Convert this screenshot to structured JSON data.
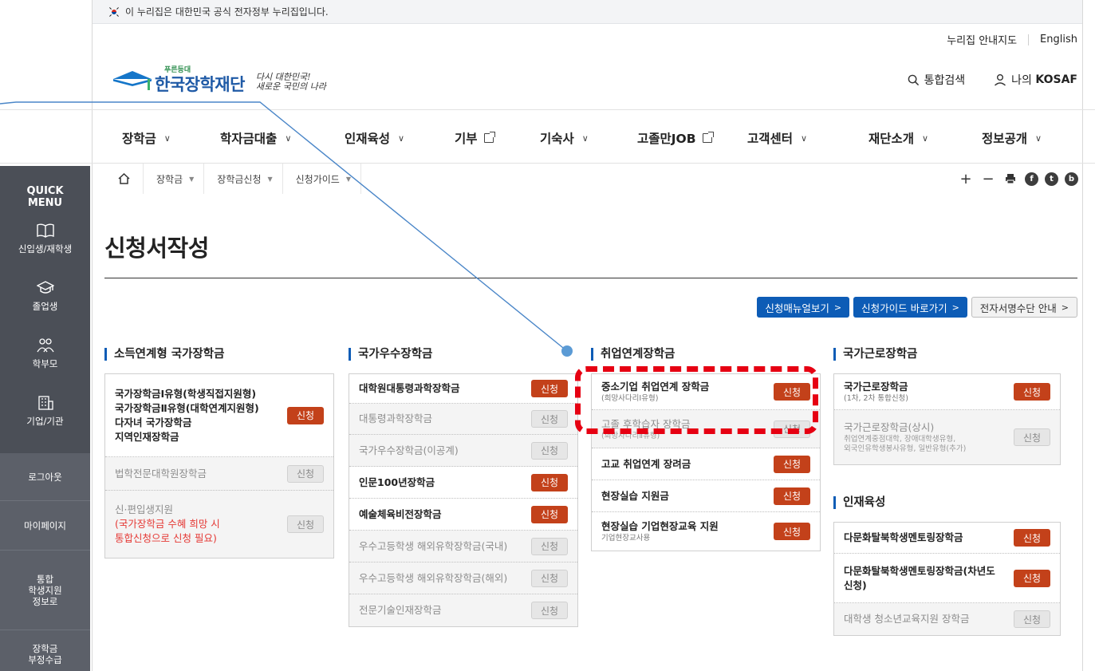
{
  "gov_banner": "이 누리집은 대한민국 공식 전자정부 누리집입니다.",
  "util_links": {
    "sitemap": "누리집 안내지도",
    "english": "English"
  },
  "logo": {
    "sub": "푸른등대",
    "name": "한국장학재단",
    "slogan_line1": "다시 대한민국!",
    "slogan_line2": "새로운 국민의 나라"
  },
  "header": {
    "search": "통합검색",
    "my_prefix": "나의",
    "my_brand": "KOSAF"
  },
  "gnb": [
    {
      "label": "장학금",
      "chev": "∨"
    },
    {
      "label": "학자금대출",
      "chev": "∨"
    },
    {
      "label": "인재육성",
      "chev": "∨"
    },
    {
      "label": "기부",
      "ext": true
    },
    {
      "label": "기숙사",
      "chev": "∨"
    },
    {
      "label": "고졸만JOB",
      "ext": true
    },
    {
      "label": "고객센터",
      "chev": "∨"
    },
    {
      "label": "재단소개",
      "chev": "∨"
    },
    {
      "label": "정보공개",
      "chev": "∨"
    }
  ],
  "quick_menu": {
    "title_line1": "QUICK",
    "title_line2": "MENU",
    "items": [
      "신입생/재학생",
      "졸업생",
      "학부모",
      "기업/기관"
    ],
    "links": [
      "로그아웃",
      "마이페이지",
      "통합\n학생지원\n정보로",
      "장학금\n부정수급"
    ]
  },
  "breadcrumb": [
    "장학금",
    "장학금신청",
    "신청가이드"
  ],
  "page_title": "신청서작성",
  "top_buttons": {
    "manual": "신청매뉴얼보기",
    "guide": "신청가이드 바로가기",
    "esign": "전자서명수단 안내"
  },
  "apply_label": "신청",
  "columns": {
    "income": {
      "title": "소득연계형 국가장학금",
      "rows": [
        {
          "lines": [
            "국가장학금Ⅰ유형(학생직접지원형)",
            "국가장학금Ⅱ유형(대학연계지원형)",
            "다자녀 국가장학금",
            "지역인재장학금"
          ],
          "active": true
        },
        {
          "label": "법학전문대학원장학금",
          "active": false
        },
        {
          "label": "신·편입생지원",
          "red": "(국가장학금 수혜 희망 시\n통합신청으로 신청 필요)",
          "active": false
        }
      ]
    },
    "excellence": {
      "title": "국가우수장학금",
      "rows": [
        {
          "label": "대학원대통령과학장학금",
          "active": true
        },
        {
          "label": "대통령과학장학금",
          "active": false
        },
        {
          "label": "국가우수장학금(이공계)",
          "active": false
        },
        {
          "label": "인문100년장학금",
          "active": true
        },
        {
          "label": "예술체육비전장학금",
          "active": true
        },
        {
          "label": "우수고등학생 해외유학장학금(국내)",
          "active": false
        },
        {
          "label": "우수고등학생 해외유학장학금(해외)",
          "active": false
        },
        {
          "label": "전문기술인재장학금",
          "active": false
        }
      ]
    },
    "employment": {
      "title": "취업연계장학금",
      "rows": [
        {
          "label": "중소기업 취업연계 장학금",
          "sub": "(희망사다리Ⅰ유형)",
          "active": true
        },
        {
          "label": "고졸 후학습자 장학금",
          "sub": "(희망사다리Ⅱ유형)",
          "active": false
        },
        {
          "label": "고교 취업연계 장려금",
          "active": true
        },
        {
          "label": "현장실습 지원금",
          "active": true
        },
        {
          "label": "현장실습 기업현장교육 지원",
          "sub": "기업현장교사용",
          "active": true
        }
      ]
    },
    "work": {
      "title": "국가근로장학금",
      "rows": [
        {
          "label": "국가근로장학금",
          "sub": "(1차, 2차 통합신청)",
          "active": true
        },
        {
          "label": "국가근로장학금(상시)",
          "sub": "취업연계중점대학, 장애대학생유형,\n외국인유학생봉사유형, 일반유형(추가)",
          "active": false
        }
      ]
    },
    "talent": {
      "title": "인재육성",
      "rows": [
        {
          "label": "다문화탈북학생멘토링장학금",
          "active": true
        },
        {
          "label": "다문화탈북학생멘토링장학금(차년도 신청)",
          "active": true
        },
        {
          "label": "대학생 청소년교육지원 장학금",
          "active": false
        }
      ]
    }
  }
}
